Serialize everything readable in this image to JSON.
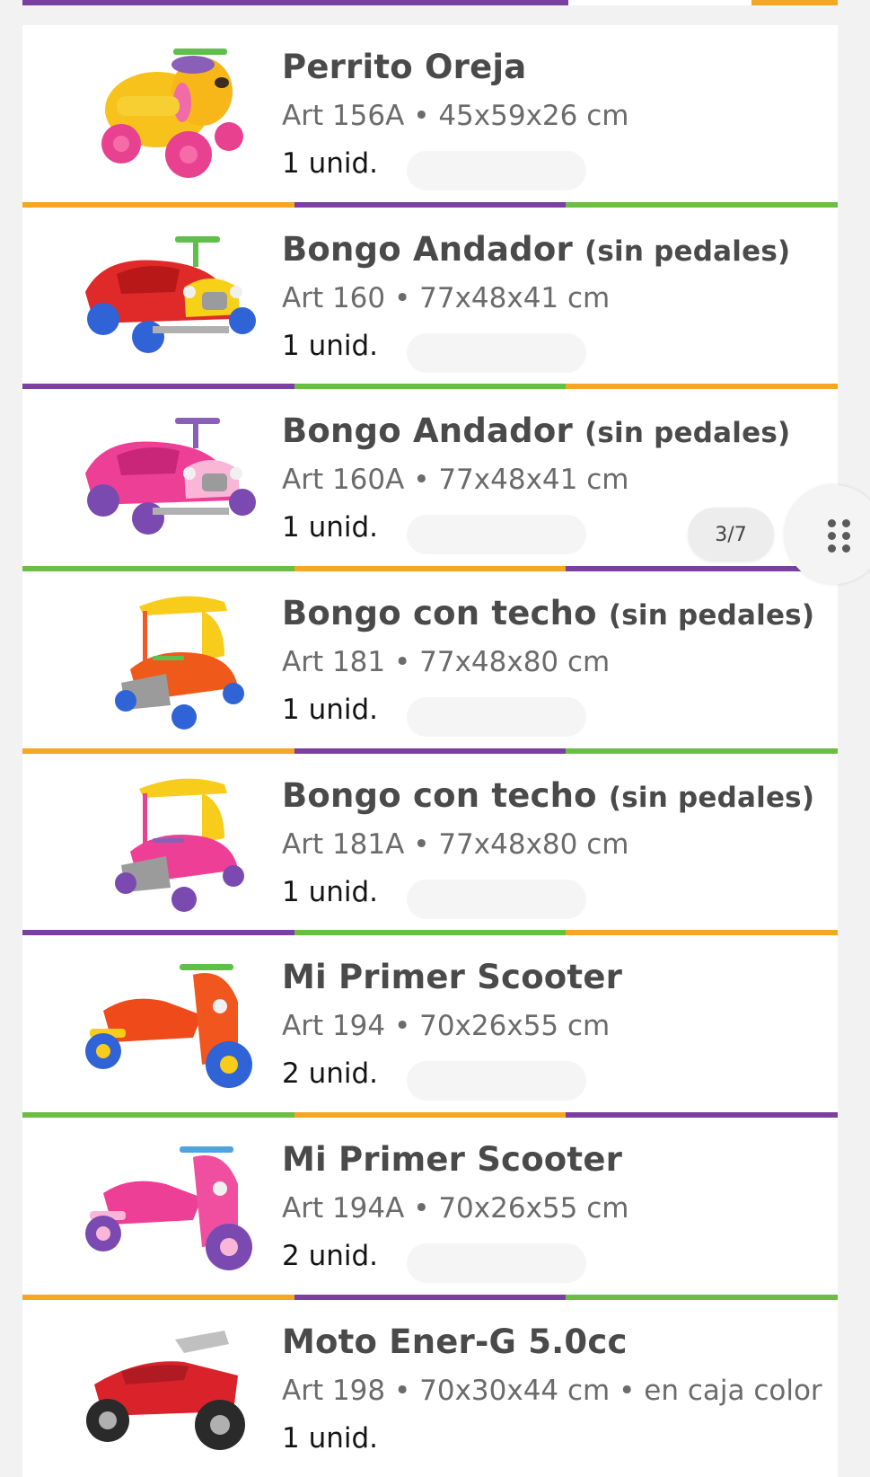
{
  "colors": {
    "purple": "#7b3fa0",
    "green": "#6cbd45",
    "orange": "#f5a623"
  },
  "top_strip": [
    "purple",
    "white",
    "orange"
  ],
  "products": [
    {
      "name": "Perrito Oreja",
      "note": "",
      "spec": "Art 156A • 45x59x26 cm",
      "qty": "1 unid.",
      "image": "dog-rideon-icon",
      "divider": [
        "orange",
        "purple",
        "green"
      ]
    },
    {
      "name": "Bongo Andador",
      "note": "(sin pedales)",
      "spec": "Art 160 • 77x48x41 cm",
      "qty": "1 unid.",
      "image": "car-red-icon",
      "divider": [
        "purple",
        "green",
        "orange"
      ]
    },
    {
      "name": "Bongo Andador",
      "note": "(sin pedales)",
      "spec": "Art 160A • 77x48x41 cm",
      "qty": "1 unid.",
      "image": "car-pink-icon",
      "divider": [
        "green",
        "orange",
        "purple"
      ]
    },
    {
      "name": "Bongo con techo",
      "note": "(sin pedales)",
      "spec": "Art 181 • 77x48x80 cm",
      "qty": "1 unid.",
      "image": "roof-car-orange-icon",
      "divider": [
        "orange",
        "purple",
        "green"
      ]
    },
    {
      "name": "Bongo con techo",
      "note": "(sin pedales)",
      "spec": "Art 181A • 77x48x80 cm",
      "qty": "1 unid.",
      "image": "roof-car-pink-icon",
      "divider": [
        "purple",
        "green",
        "orange"
      ]
    },
    {
      "name": "Mi Primer Scooter",
      "note": "",
      "spec": "Art 194 • 70x26x55 cm",
      "qty": "2 unid.",
      "image": "scooter-orange-icon",
      "divider": [
        "green",
        "orange",
        "purple"
      ]
    },
    {
      "name": "Mi Primer Scooter",
      "note": "",
      "spec": "Art 194A • 70x26x55 cm",
      "qty": "2 unid.",
      "image": "scooter-pink-icon",
      "divider": [
        "orange",
        "purple",
        "green"
      ]
    },
    {
      "name": "Moto Ener-G 5.0cc",
      "note": "",
      "spec": "Art 198 • 70x30x44 cm • en caja color",
      "qty": "1 unid.",
      "image": "motorbike-red-icon",
      "divider": []
    }
  ],
  "page_counter": "3/7"
}
